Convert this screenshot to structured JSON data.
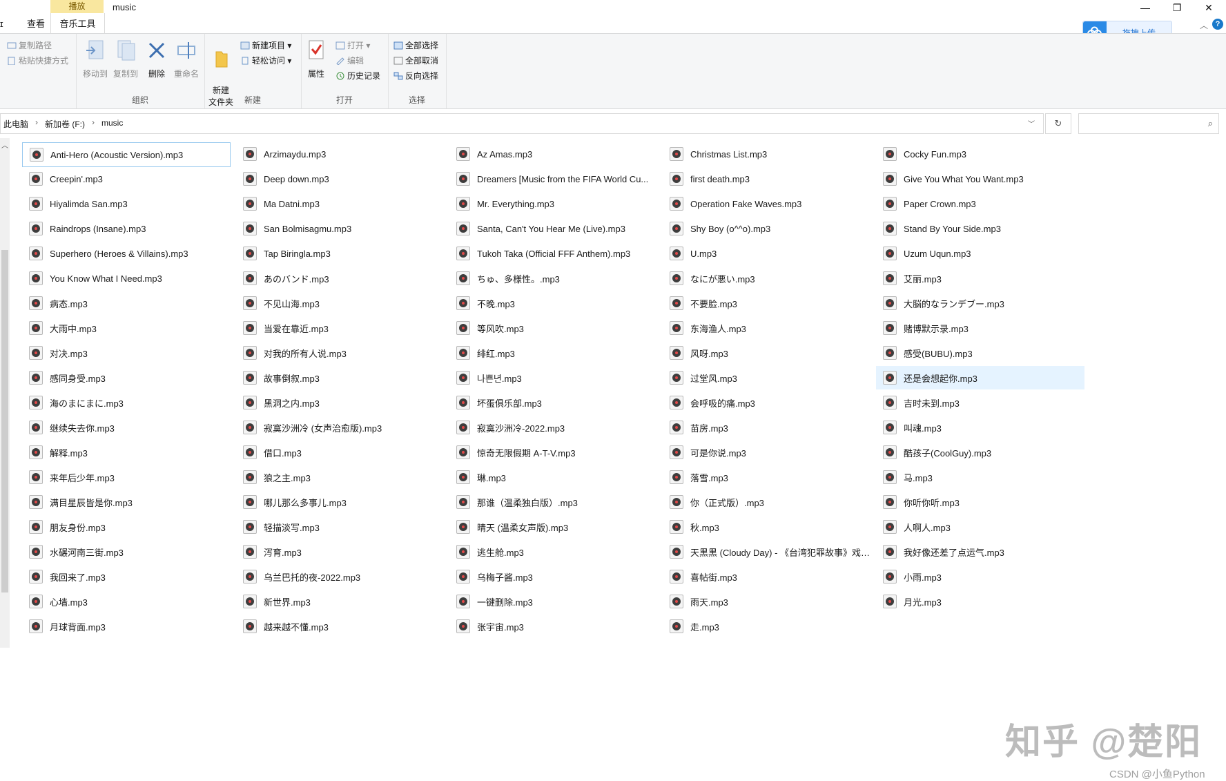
{
  "window": {
    "title": "music",
    "tabs": {
      "file_stub": "ɪ",
      "view": "查看",
      "context_group": "播放",
      "context_tab": "音乐工具"
    },
    "controls": {
      "minimize": "—",
      "maximize": "❐",
      "close": "✕"
    },
    "cloud_upload": "拖拽上传",
    "help": "?"
  },
  "ribbon": {
    "clipboard": {
      "copy_path": "复制路径",
      "paste_shortcut": "粘贴快捷方式"
    },
    "organize": {
      "move_to": "移动到",
      "copy_to": "复制到",
      "delete": "删除",
      "rename": "重命名",
      "label": "组织"
    },
    "new": {
      "new_folder": "新建\n文件夹",
      "new_item": "新建项目 ▾",
      "easy_access": "轻松访问 ▾",
      "label": "新建"
    },
    "open": {
      "properties": "属性",
      "open": "打开 ▾",
      "edit": "编辑",
      "history": "历史记录",
      "label": "打开"
    },
    "select": {
      "select_all": "全部选择",
      "select_none": "全部取消",
      "invert": "反向选择",
      "label": "选择"
    }
  },
  "address": {
    "crumbs": [
      "此电脑",
      "新加卷 (F:)",
      "music"
    ],
    "separator": "›",
    "dropdown": "﹀",
    "refresh": "↻",
    "search_placeholder": ""
  },
  "files": [
    "Anti-Hero (Acoustic Version).mp3",
    "Arzimaydu.mp3",
    "Az Amas.mp3",
    "Christmas List.mp3",
    "Cocky Fun.mp3",
    "Creepin'.mp3",
    "Deep down.mp3",
    "Dreamers [Music from the FIFA World Cu...",
    "first death.mp3",
    "Give You What You Want.mp3",
    "Hiyalimda San.mp3",
    "Ma Datni.mp3",
    "Mr. Everything.mp3",
    "Operation Fake Waves.mp3",
    "Paper Crown.mp3",
    "Raindrops (Insane).mp3",
    "San Bolmisagmu.mp3",
    "Santa, Can't You Hear Me (Live).mp3",
    "Shy Boy (o^^o).mp3",
    "Stand By Your Side.mp3",
    "Superhero (Heroes & Villains).mp3",
    "Tap Biringla.mp3",
    "Tukoh Taka (Official FFF Anthem).mp3",
    "U.mp3",
    "Uzum Uqun.mp3",
    "You Know What I Need.mp3",
    "あのバンド.mp3",
    "ちゅ、多様性。.mp3",
    "なにが悪い.mp3",
    "艾丽.mp3",
    "病态.mp3",
    "不见山海.mp3",
    "不晚.mp3",
    "不要脸.mp3",
    "大脳的なランデブー.mp3",
    "大雨中.mp3",
    "当爱在靠近.mp3",
    "等风吹.mp3",
    "东海渔人.mp3",
    "赌博默示录.mp3",
    "对决.mp3",
    "对我的所有人说.mp3",
    "绯红.mp3",
    "风呀.mp3",
    "感受(BUBU).mp3",
    "感同身受.mp3",
    "故事倒叙.mp3",
    "나쁜년.mp3",
    "过堂风.mp3",
    "还是会想起你.mp3",
    "海のまにまに.mp3",
    "黑洞之内.mp3",
    "坏蛋俱乐部.mp3",
    "会呼吸的痛.mp3",
    "吉时未到.mp3",
    "继续失去你.mp3",
    "寂寞沙洲冷 (女声治愈版).mp3",
    "寂寞沙洲冷-2022.mp3",
    "苗房.mp3",
    "叫魂.mp3",
    "解释.mp3",
    "借口.mp3",
    "惊奇无限假期 A-T-V.mp3",
    "可是你说.mp3",
    "酷孩子(CoolGuy).mp3",
    "来年后少年.mp3",
    "狼之主.mp3",
    "琳.mp3",
    "落雪.mp3",
    "马.mp3",
    "满目星辰皆是你.mp3",
    "哪儿那么多事儿.mp3",
    "那谁（温柔独白版）.mp3",
    "你（正式版）.mp3",
    "你听你听.mp3",
    "朋友身份.mp3",
    "轻描淡写.mp3",
    "晴天 (温柔女声版).mp3",
    "秋.mp3",
    "人啊人.mp3",
    "水碾河南三街.mp3",
    "泻育.mp3",
    "逃生舱.mp3",
    "天黑黑 (Cloudy Day) - 《台湾犯罪故事》戏剧...",
    "我好像还差了点运气.mp3",
    "我回来了.mp3",
    "乌兰巴托的夜-2022.mp3",
    "乌梅子酱.mp3",
    "喜帖街.mp3",
    "小雨.mp3",
    "心墙.mp3",
    "新世界.mp3",
    "一键删除.mp3",
    "雨天.mp3",
    "月光.mp3",
    "月球背面.mp3",
    "越来越不懂.mp3",
    "张宇宙.mp3",
    "走.mp3"
  ],
  "watermark": "知乎 @楚阳",
  "csdn": "CSDN @小鱼Python"
}
